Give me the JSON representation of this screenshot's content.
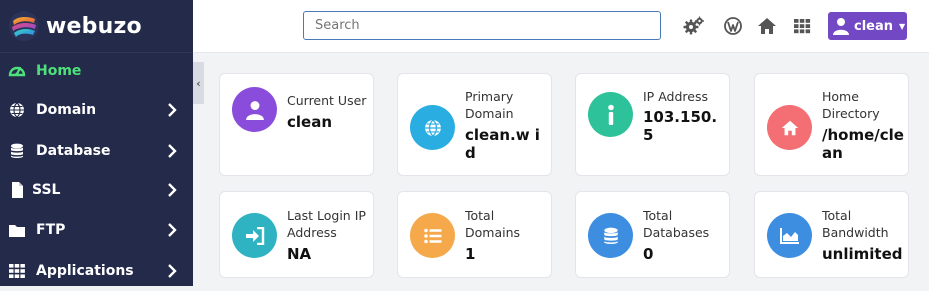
{
  "brand": {
    "name": "webuzo"
  },
  "sidebar": {
    "items": [
      {
        "label": "Home",
        "icon": "dashboard-icon",
        "active": true
      },
      {
        "label": "Domain",
        "icon": "globe-icon"
      },
      {
        "label": "Database",
        "icon": "database-icon"
      },
      {
        "label": "SSL",
        "icon": "file-icon"
      },
      {
        "label": "FTP",
        "icon": "folder-icon"
      },
      {
        "label": "Applications",
        "icon": "grid-icon"
      }
    ],
    "collapse_glyph": "‹"
  },
  "topbar": {
    "search_placeholder": "Search",
    "user_label": "clean",
    "caret": "▼",
    "icons": [
      "settings-icon",
      "wordpress-icon",
      "home-icon",
      "apps-grid-icon"
    ]
  },
  "cards": [
    {
      "label": "Current User",
      "value": "clean",
      "color": "#8a4ddb",
      "icon": "user-icon"
    },
    {
      "label": "Primary Domain",
      "value": "clean.w id",
      "color": "#2aaee2",
      "icon": "globe-icon"
    },
    {
      "label": "IP Address",
      "value": "103.150. 5",
      "color": "#2dc29a",
      "icon": "info-icon"
    },
    {
      "label": "Home Directory",
      "value": "/home/clean",
      "color": "#f36f73",
      "icon": "home-icon"
    },
    {
      "label": "Last Login IP Address",
      "value": "NA",
      "color": "#2fb3c2",
      "icon": "login-icon"
    },
    {
      "label": "Total Domains",
      "value": "1",
      "color": "#f5a94a",
      "icon": "list-icon"
    },
    {
      "label": "Total Databases",
      "value": "0",
      "color": "#3d8de0",
      "icon": "database-icon"
    },
    {
      "label": "Total Bandwidth",
      "value": "unlimited",
      "color": "#3d8de0",
      "icon": "chart-icon"
    }
  ],
  "colors": {
    "sidebar_bg": "#232a4a",
    "active": "#4ee07a",
    "accent": "#7248c4",
    "search_border": "#4a79b8"
  }
}
